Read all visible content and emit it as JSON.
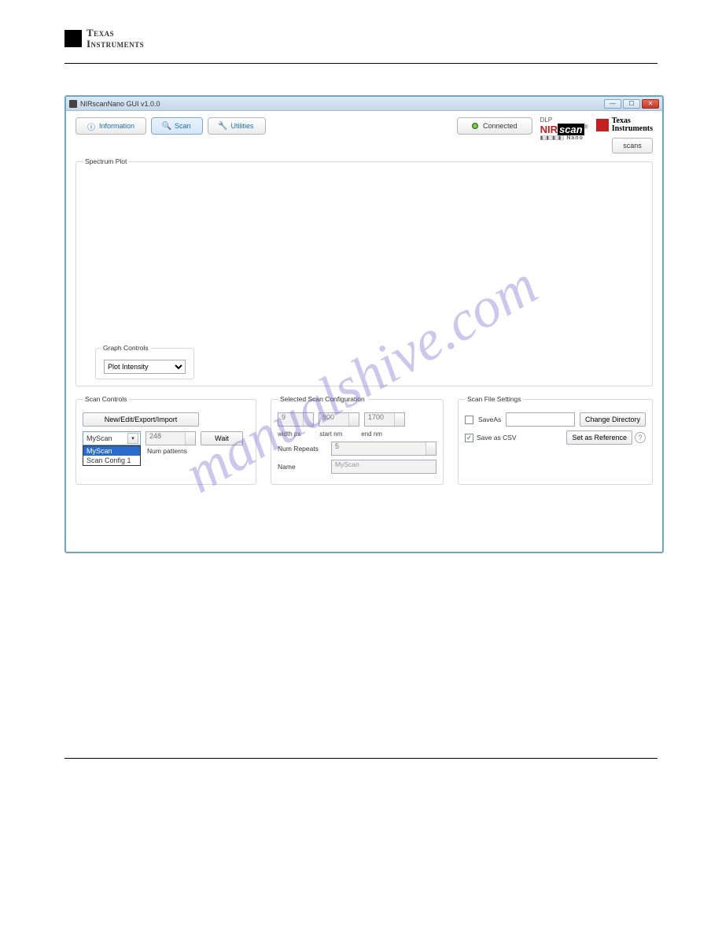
{
  "header": {
    "brand1": "Texas",
    "brand2": "Instruments"
  },
  "watermark": "manualshive.com",
  "window": {
    "title": "NIRscanNano GUI v1.0.0"
  },
  "topbar": {
    "info_label": "Information",
    "scan_label": "Scan",
    "utilities_label": "Utilities",
    "connected_label": "Connected",
    "scans_label": "scans",
    "nirscan": {
      "dlp": "DLP",
      "nir": "NIR",
      "scan": "scan",
      "nano": "Nano"
    },
    "ti_brand1": "Texas",
    "ti_brand2": "Instruments"
  },
  "plot": {
    "title": "Spectrum Plot",
    "graph_controls_title": "Graph Controls",
    "graph_mode": "Plot Intensity"
  },
  "scan_controls": {
    "title": "Scan Controls",
    "new_btn": "New/Edit/Export/Import",
    "dropdown_value": "MyScan",
    "dropdown_items": [
      "MyScan",
      "Scan Config 1"
    ],
    "num_value": "248",
    "wait_label": "Wait",
    "num_patterns_label": "Num patterns"
  },
  "selected_cfg": {
    "title": "Selected Scan Configuration",
    "val1": "9",
    "val2": "900",
    "val3": "1700",
    "label_width": "width px",
    "label_start": "start nm",
    "label_end": "end nm",
    "num_repeats_label": "Num Repeats",
    "num_repeats_value": "5",
    "name_label": "Name",
    "name_value": "MyScan"
  },
  "file_settings": {
    "title": "Scan File Settings",
    "saveas_label": "SaveAs",
    "change_dir_label": "Change Directory",
    "save_csv_label": "Save as CSV",
    "set_ref_label": "Set as Reference"
  }
}
